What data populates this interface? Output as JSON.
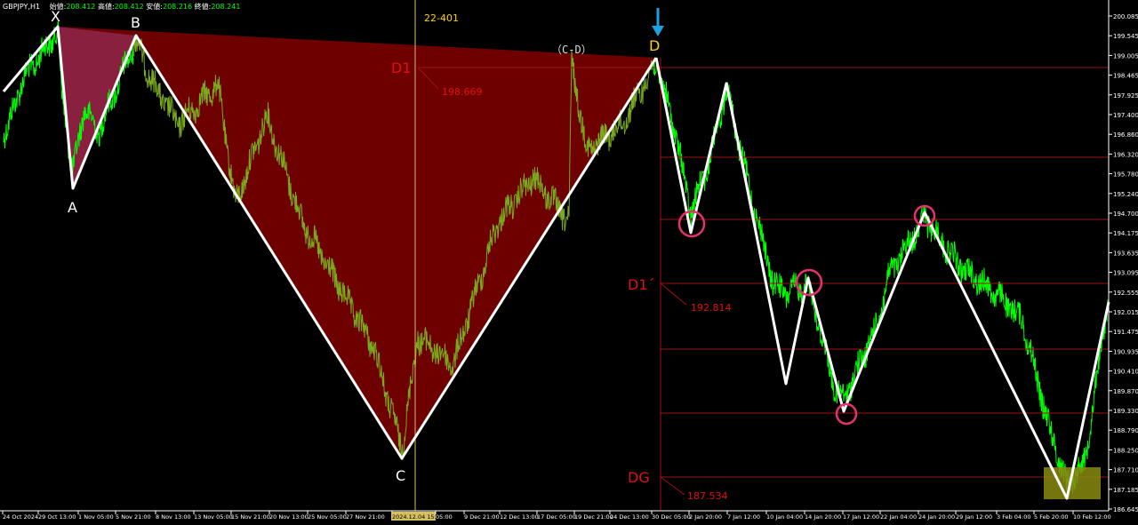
{
  "header": {
    "symbol": "GBPJPY,H1",
    "open_label": "始値:",
    "open": "208.412",
    "high_label": "高値:",
    "high": "208.412",
    "low_label": "安値:",
    "low": "208.216",
    "close_label": "終値:",
    "close": "208.241"
  },
  "annotation_id": "22-401",
  "pattern_labels": {
    "X": "X",
    "A": "A",
    "B": "B",
    "C": "C",
    "D": "D",
    "CD": "（C-D）"
  },
  "levels": {
    "d1": {
      "label": "D1",
      "value": "198.669"
    },
    "d1p": {
      "label": "D1´",
      "value": "192.814"
    },
    "dg": {
      "label": "DG",
      "value": "187.534"
    }
  },
  "y_axis_ticks": [
    "200.085",
    "199.545",
    "199.005",
    "198.465",
    "197.925",
    "197.400",
    "196.860",
    "196.320",
    "195.780",
    "195.240",
    "194.700",
    "194.175",
    "193.635",
    "193.095",
    "192.555",
    "192.015",
    "191.475",
    "190.935",
    "190.410",
    "189.870",
    "189.330",
    "188.790",
    "188.250",
    "187.710",
    "187.185",
    "186.645"
  ],
  "x_axis_ticks": [
    "24 Oct 2024",
    "29 Oct 13:00",
    "1 Nov 05:00",
    "5 Nov 21:00",
    "8 Nov 13:00",
    "13 Nov 05:00",
    "15 Nov 21:00",
    "20 Nov 13:00",
    "25 Nov 05:00",
    "27 Nov 21:00",
    "2024.12.04 15:00",
    "05:00",
    "9 Dec 21:00",
    "12 Dec 13:00",
    "17 Dec 05:00",
    "19 Dec 21:00",
    "24 Dec 13:00",
    "30 Dec 05:00",
    "2 Jan 20:00",
    "7 Jan 12:00",
    "10 Jan 04:00",
    "14 Jan 20:00",
    "17 Jan 12:00",
    "22 Jan 04:00",
    "24 Jan 20:00",
    "29 Jan 12:00",
    "3 Feb 04:00",
    "5 Feb 20:00",
    "10 Feb 12:00"
  ],
  "colors": {
    "background": "#000000",
    "price_line": "#00ff00",
    "price_line_in_pattern": "#7aa81e",
    "pattern_fill": "#6e0000",
    "pattern_fill_xa": "#8a2040",
    "zigzag": "#ffffff",
    "level_line": "#a01010",
    "level_text": "#e01010",
    "marker_circle": "#e83070",
    "current_highlight": "#8a8a10",
    "arrow": "#1ea0e0",
    "d_label": "#ffd200",
    "annotation_text": "#ffd200"
  }
}
